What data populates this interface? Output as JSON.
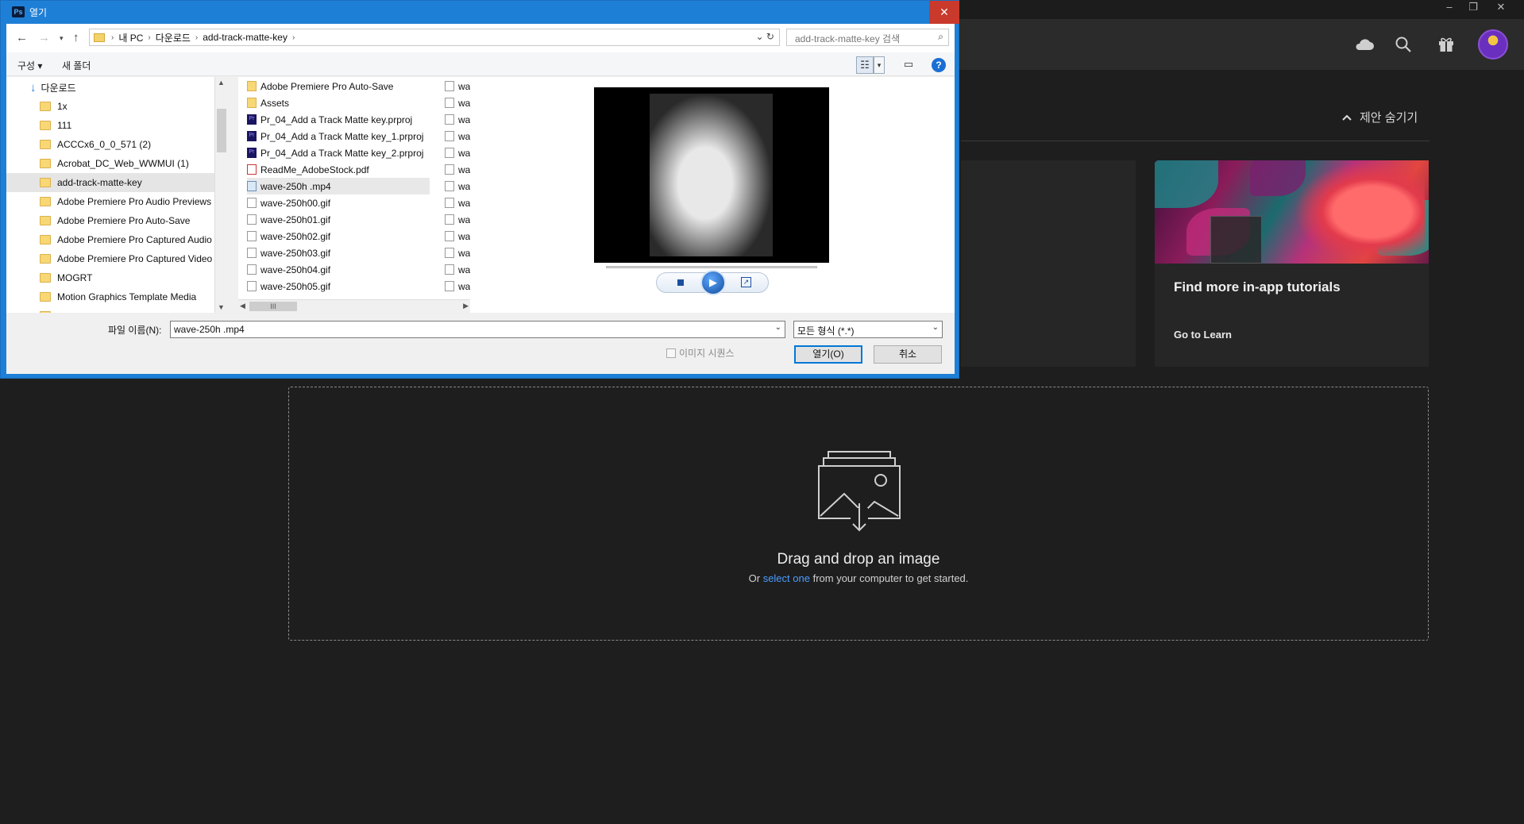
{
  "dialog": {
    "app_badge": "Ps",
    "title": "열기",
    "close_label": "✕",
    "breadcrumb": [
      "내 PC",
      "다운로드",
      "add-track-matte-key"
    ],
    "search_placeholder": "add-track-matte-key 검색",
    "toolbar": {
      "organize": "구성 ▾",
      "new_folder": "새 폴더",
      "help": "?"
    },
    "tree": [
      {
        "label": "다운로드",
        "type": "download"
      },
      {
        "label": "1x",
        "type": "folder"
      },
      {
        "label": "111",
        "type": "folder"
      },
      {
        "label": "ACCCx6_0_0_571 (2)",
        "type": "folder"
      },
      {
        "label": "Acrobat_DC_Web_WWMUI (1)",
        "type": "folder"
      },
      {
        "label": "add-track-matte-key",
        "type": "folder",
        "selected": true
      },
      {
        "label": "Adobe Premiere Pro Audio Previews",
        "type": "folder"
      },
      {
        "label": "Adobe Premiere Pro Auto-Save",
        "type": "folder"
      },
      {
        "label": "Adobe Premiere Pro Captured Audio",
        "type": "folder"
      },
      {
        "label": "Adobe Premiere Pro Captured Video",
        "type": "folder"
      },
      {
        "label": "MOGRT",
        "type": "folder"
      },
      {
        "label": "Motion Graphics Template Media",
        "type": "folder"
      }
    ],
    "files": [
      {
        "name": "Adobe Premiere Pro Auto-Save",
        "kind": "folder"
      },
      {
        "name": "Assets",
        "kind": "folder"
      },
      {
        "name": "Pr_04_Add a Track Matte key.prproj",
        "kind": "prproj"
      },
      {
        "name": "Pr_04_Add a Track Matte key_1.prproj",
        "kind": "prproj"
      },
      {
        "name": "Pr_04_Add a Track Matte key_2.prproj",
        "kind": "prproj"
      },
      {
        "name": "ReadMe_AdobeStock.pdf",
        "kind": "pdf"
      },
      {
        "name": "wave-250h .mp4",
        "kind": "video",
        "selected": true
      },
      {
        "name": "wave-250h00.gif",
        "kind": "gif"
      },
      {
        "name": "wave-250h01.gif",
        "kind": "gif"
      },
      {
        "name": "wave-250h02.gif",
        "kind": "gif"
      },
      {
        "name": "wave-250h03.gif",
        "kind": "gif"
      },
      {
        "name": "wave-250h04.gif",
        "kind": "gif"
      },
      {
        "name": "wave-250h05.gif",
        "kind": "gif"
      }
    ],
    "second_column_prefix": "wa",
    "filename_label": "파일 이름(N):",
    "filename_value": "wave-250h .mp4",
    "file_type": "모든 형식 (*.*)",
    "image_sequence_label": "이미지 시퀀스",
    "open_button": "열기(O)",
    "cancel_button": "취소"
  },
  "photoshop": {
    "hide_suggestions": "제안 숨기기",
    "tutorial_card": {
      "title": "Find more in-app tutorials",
      "link": "Go to Learn"
    },
    "dropzone": {
      "title": "Drag and drop an image",
      "sub_prefix": "Or",
      "sub_link": "select one",
      "sub_suffix": "from your computer to get started."
    },
    "icons": [
      "cloud-icon",
      "search-icon",
      "gift-icon",
      "avatar"
    ]
  }
}
